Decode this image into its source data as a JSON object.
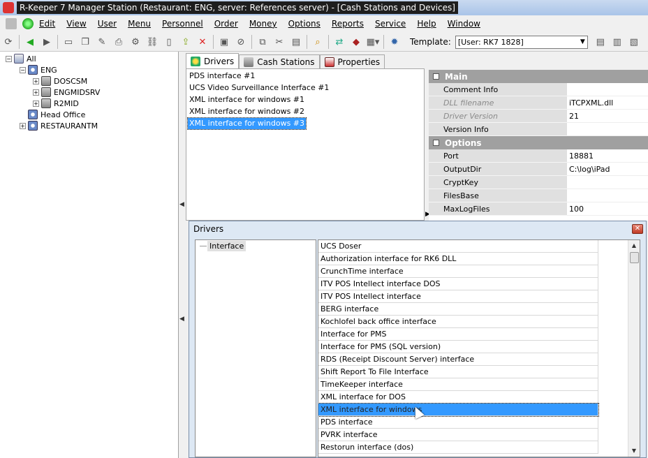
{
  "window": {
    "title": "R-Keeper 7 Manager Station (Restaurant: ENG, server: References server) - [Cash Stations and Devices]"
  },
  "menu": {
    "items": [
      "Edit",
      "View",
      "User",
      "Menu",
      "Personnel",
      "Order",
      "Money",
      "Options",
      "Reports",
      "Service",
      "Help",
      "Window"
    ]
  },
  "toolbar": {
    "template_label": "Template:",
    "template_value": "[User: RK7 1828]"
  },
  "tree": {
    "root": "All",
    "restaurant": "ENG",
    "children": [
      "DOSCSM",
      "ENGMIDSRV",
      "R2MID"
    ],
    "head_office": "Head Office",
    "other": "RESTAURANTM"
  },
  "tabs": [
    "Drivers",
    "Cash Stations",
    "Properties"
  ],
  "drivers": [
    "PDS interface #1",
    "UCS Video Surveillance Interface #1",
    "XML interface for windows #1",
    "XML interface for windows #2",
    "XML interface for windows #3"
  ],
  "properties": {
    "main_label": "Main",
    "options_label": "Options",
    "main": [
      {
        "name": "Comment Info",
        "value": ""
      },
      {
        "name": "DLL filename",
        "value": "iTCPXML.dll"
      },
      {
        "name": "Driver Version",
        "value": "21"
      },
      {
        "name": "Version Info",
        "value": ""
      }
    ],
    "options": [
      {
        "name": "Port",
        "value": "18881"
      },
      {
        "name": "OutputDir",
        "value": "C:\\log\\iPad"
      },
      {
        "name": "CryptKey",
        "value": ""
      },
      {
        "name": "FilesBase",
        "value": ""
      },
      {
        "name": "MaxLogFiles",
        "value": "100"
      }
    ]
  },
  "dialog": {
    "title": "Drivers",
    "tree_label": "Interface",
    "items": [
      "UCS Doser",
      "Authorization interface for RK6 DLL",
      "CrunchTime interface",
      "ITV POS Intellect interface DOS",
      "ITV POS Intellect interface",
      "BERG interface",
      "Kochlofel back office interface",
      "Interface for PMS",
      "Interface for PMS (SQL version)",
      "RDS (Receipt Discount Server) interface",
      "Shift Report To File Interface",
      "TimeKeeper interface",
      "XML interface for DOS",
      "XML interface for windows",
      "PDS interface",
      "PVRK interface",
      "Restorun interface (dos)"
    ]
  }
}
